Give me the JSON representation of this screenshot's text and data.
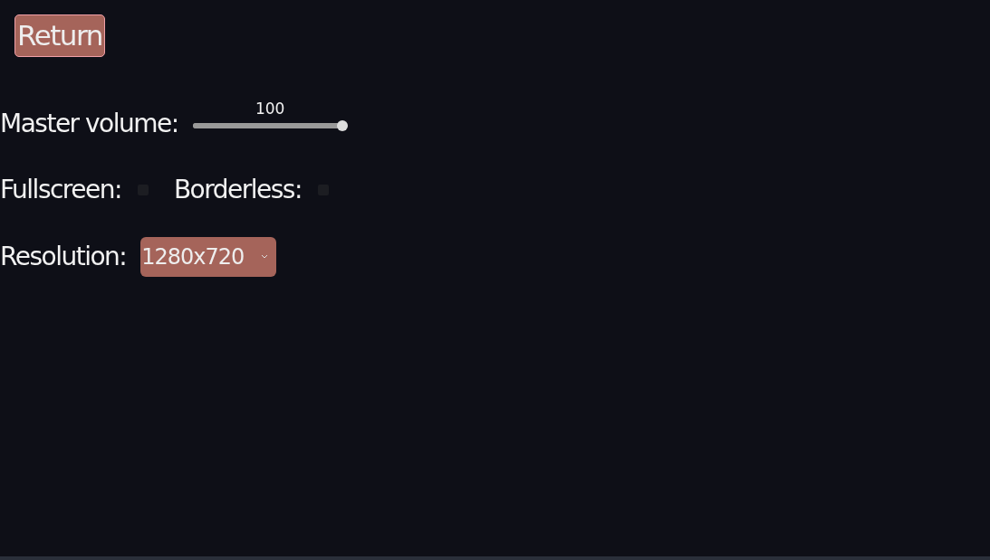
{
  "return_button": {
    "label": "Return"
  },
  "volume": {
    "label": "Master volume:",
    "reading": "100",
    "level": 1.0
  },
  "toggles": [
    {
      "label": "Fullscreen:",
      "checked": false
    },
    {
      "label": "Borderless:",
      "checked": false
    }
  ],
  "resolution": {
    "label": "Resolution:",
    "value": "1280x720"
  }
}
